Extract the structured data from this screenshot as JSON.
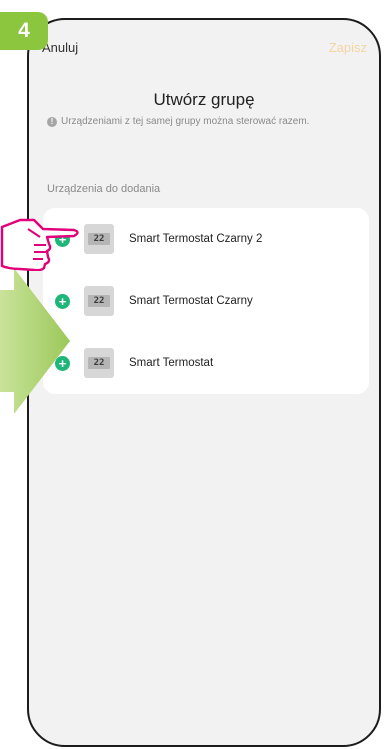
{
  "step": {
    "number": "4"
  },
  "topbar": {
    "cancel_label": "Anuluj",
    "save_label": "Zapisz"
  },
  "page": {
    "title": "Utwórz grupę",
    "info_text": "Urządzeniami z tej samej grupy można sterować razem."
  },
  "devices": {
    "section_label": "Urządzenia do dodania",
    "thumbnail_display": "22",
    "items": [
      {
        "name": "Smart Termostat Czarny 2"
      },
      {
        "name": "Smart Termostat Czarny"
      },
      {
        "name": "Smart Termostat"
      }
    ]
  },
  "colors": {
    "step_badge": "#8cc63f",
    "add_button": "#1fb67a",
    "save_disabled": "#f3d6a4",
    "pointer_hand": "#e2007a",
    "hint_arrow": "#b4d57a"
  },
  "icons": [
    "add-circle-icon",
    "info-icon",
    "thermostat-thumbnail",
    "pointing-hand-icon",
    "hint-arrow"
  ]
}
